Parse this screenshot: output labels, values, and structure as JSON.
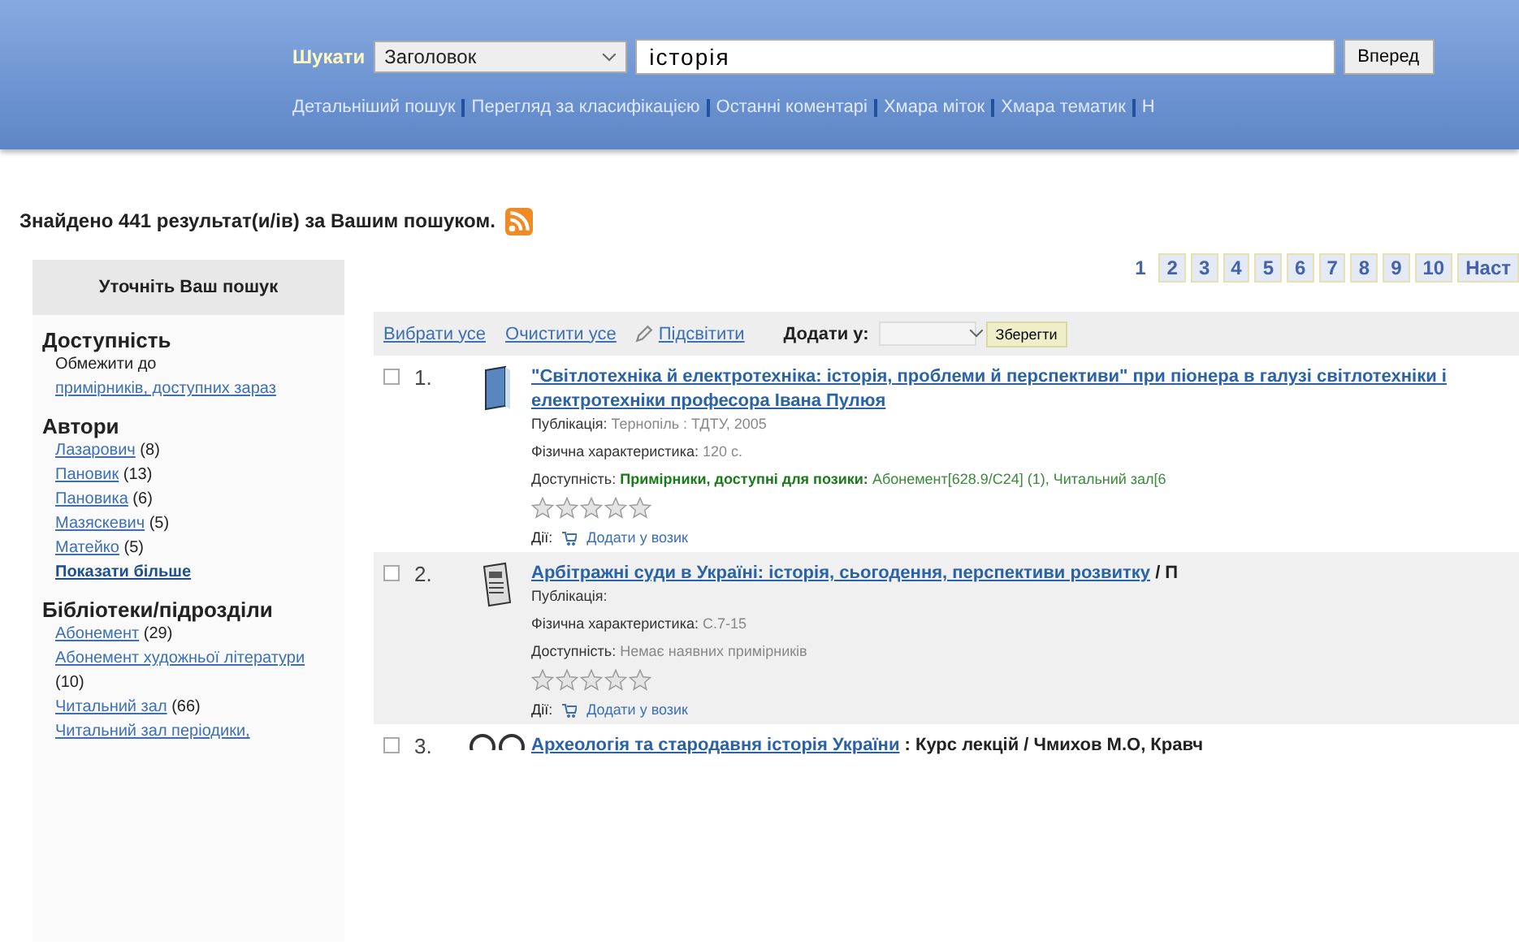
{
  "search": {
    "label": "Шукати",
    "field_option": "Заголовок",
    "query": "історія",
    "button": "Вперед"
  },
  "nav_links": [
    "Детальніший пошук",
    "Перегляд за класифікацією",
    "Останні коментарі",
    "Хмара міток",
    "Хмара тематик",
    "Н"
  ],
  "results_heading": "Знайдено 441 результат(и/ів) за Вашим пошуком.",
  "sidebar": {
    "title": "Уточніть Ваш пошук",
    "sections": [
      {
        "heading": "Доступність",
        "note": "Обмежити до",
        "items": [
          {
            "label": "примірників, доступних зараз"
          }
        ]
      },
      {
        "heading": "Автори",
        "items": [
          {
            "label": "Лазарович",
            "count": "(8)"
          },
          {
            "label": "Пановик",
            "count": "(13)"
          },
          {
            "label": "Пановика",
            "count": "(6)"
          },
          {
            "label": "Мазяскевич",
            "count": "(5)"
          },
          {
            "label": "Матейко",
            "count": "(5)"
          }
        ],
        "more": "Показати більше"
      },
      {
        "heading": "Бібліотеки/підрозділи",
        "items": [
          {
            "label": "Абонемент",
            "count": "(29)"
          },
          {
            "label": "Абонемент художньої літератури",
            "count": "(10)"
          },
          {
            "label": "Читальний зал",
            "count": "(66)"
          },
          {
            "label": "Читальний зал періодики,"
          }
        ]
      }
    ]
  },
  "pager": [
    {
      "label": "1",
      "selected": true
    },
    {
      "label": "2",
      "selected": false
    },
    {
      "label": "3",
      "selected": false
    },
    {
      "label": "4",
      "selected": false
    },
    {
      "label": "5",
      "selected": false
    },
    {
      "label": "6",
      "selected": false
    },
    {
      "label": "7",
      "selected": false
    },
    {
      "label": "8",
      "selected": false
    },
    {
      "label": "9",
      "selected": false
    },
    {
      "label": "10",
      "selected": false
    },
    {
      "label": "Наст",
      "selected": false
    }
  ],
  "toolbar": {
    "select_all": "Вибрати усе",
    "clear_all": "Очистити усе",
    "highlight": "Підсвітити",
    "add_to_label": "Додати у:",
    "save": "Зберегти"
  },
  "results": [
    {
      "number": "1.",
      "kind": "book",
      "checked": false,
      "title": "\"Світлотехніка й електротехніка: історія, проблеми й перспективи\" при піонера в галузі світлотехніки і електротехніки професора Івана Пулюя",
      "pub_label": "Публікація:",
      "pub": "Тернопіль : ТДТУ, 2005",
      "phys_label": "Фізична характеристика:",
      "phys": "120 с.",
      "avail_label": "Доступність:",
      "avail_status": "Примірники, доступні для позики:",
      "avail": "Абонемент[628.9/С24] (1), Читальний зал[6",
      "stars": 0,
      "actions_label": "Дії:",
      "cart": "Додати у возик"
    },
    {
      "number": "2.",
      "kind": "article",
      "checked": false,
      "title": "Арбітражні суди в Україні: історія, сьогодення, перспективи розвитку",
      "title_rest": " / П",
      "pub_label": "Публікація:",
      "phys_label": "Фізична характеристика:",
      "phys": "С.7-15",
      "avail_label": "Доступність:",
      "avail": "Немає наявних примірників",
      "stars": 0,
      "actions_label": "Дії:",
      "cart": "Додати у возик"
    },
    {
      "number": "3.",
      "kind": "glasses",
      "checked": false,
      "title": "Археологія та стародавня історія України",
      "title_rest": " : Курс лекцій / Чмихов М.О, Кравч"
    }
  ]
}
